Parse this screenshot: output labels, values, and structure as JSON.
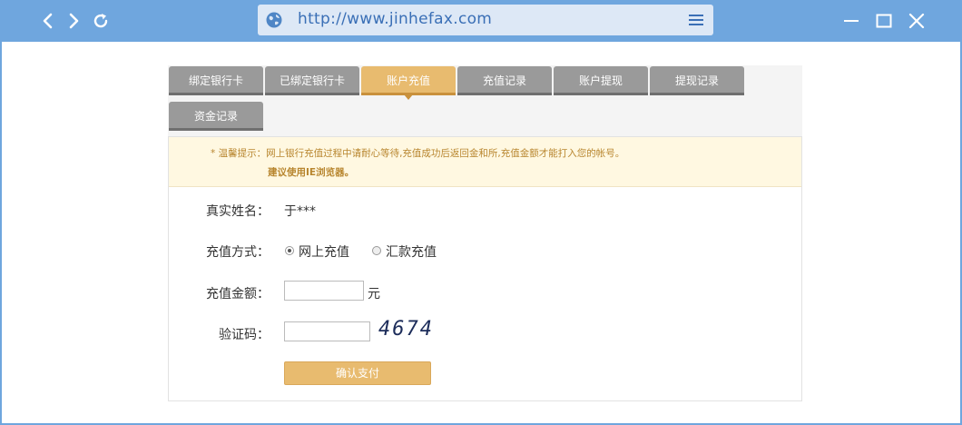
{
  "browser": {
    "url": "http://www.jinhefax.com",
    "back_icon": "chevron-left-icon",
    "forward_icon": "chevron-right-icon",
    "refresh_icon": "refresh-icon",
    "globe_icon": "globe-icon",
    "menu_icon": "hamburger-menu-icon",
    "minimize_icon": "minimize-icon",
    "maximize_icon": "maximize-icon",
    "close_icon": "close-icon"
  },
  "tabs": [
    {
      "label": "绑定银行卡",
      "active": false
    },
    {
      "label": "已绑定银行卡",
      "active": false
    },
    {
      "label": "账户充值",
      "active": true
    },
    {
      "label": "充值记录",
      "active": false
    },
    {
      "label": "账户提现",
      "active": false
    },
    {
      "label": "提现记录",
      "active": false
    },
    {
      "label": "资金记录",
      "active": false
    }
  ],
  "notice": {
    "line1": "* 温馨提示：网上银行充值过程中请耐心等待,充值成功后返回金和所,充值金额才能打入您的帐号。",
    "line2": "建议使用IE浏览器。"
  },
  "form": {
    "name_label": "真实姓名：",
    "name_value": "于***",
    "method_label": "充值方式：",
    "method_options": [
      {
        "label": "网上充值",
        "selected": true
      },
      {
        "label": "汇款充值",
        "selected": false
      }
    ],
    "amount_label": "充值金额：",
    "amount_value": "",
    "amount_unit": "元",
    "captcha_label": "验证码：",
    "captcha_value": "",
    "captcha_text": "4674",
    "submit_label": "确认支付"
  },
  "colors": {
    "browser_bar": "#6fa6de",
    "tab_default": "#9a9a9a",
    "tab_active": "#e8bb6f",
    "notice_bg": "#fff8e1",
    "notice_text": "#b8862f",
    "submit_bg": "#e8bb6f"
  }
}
